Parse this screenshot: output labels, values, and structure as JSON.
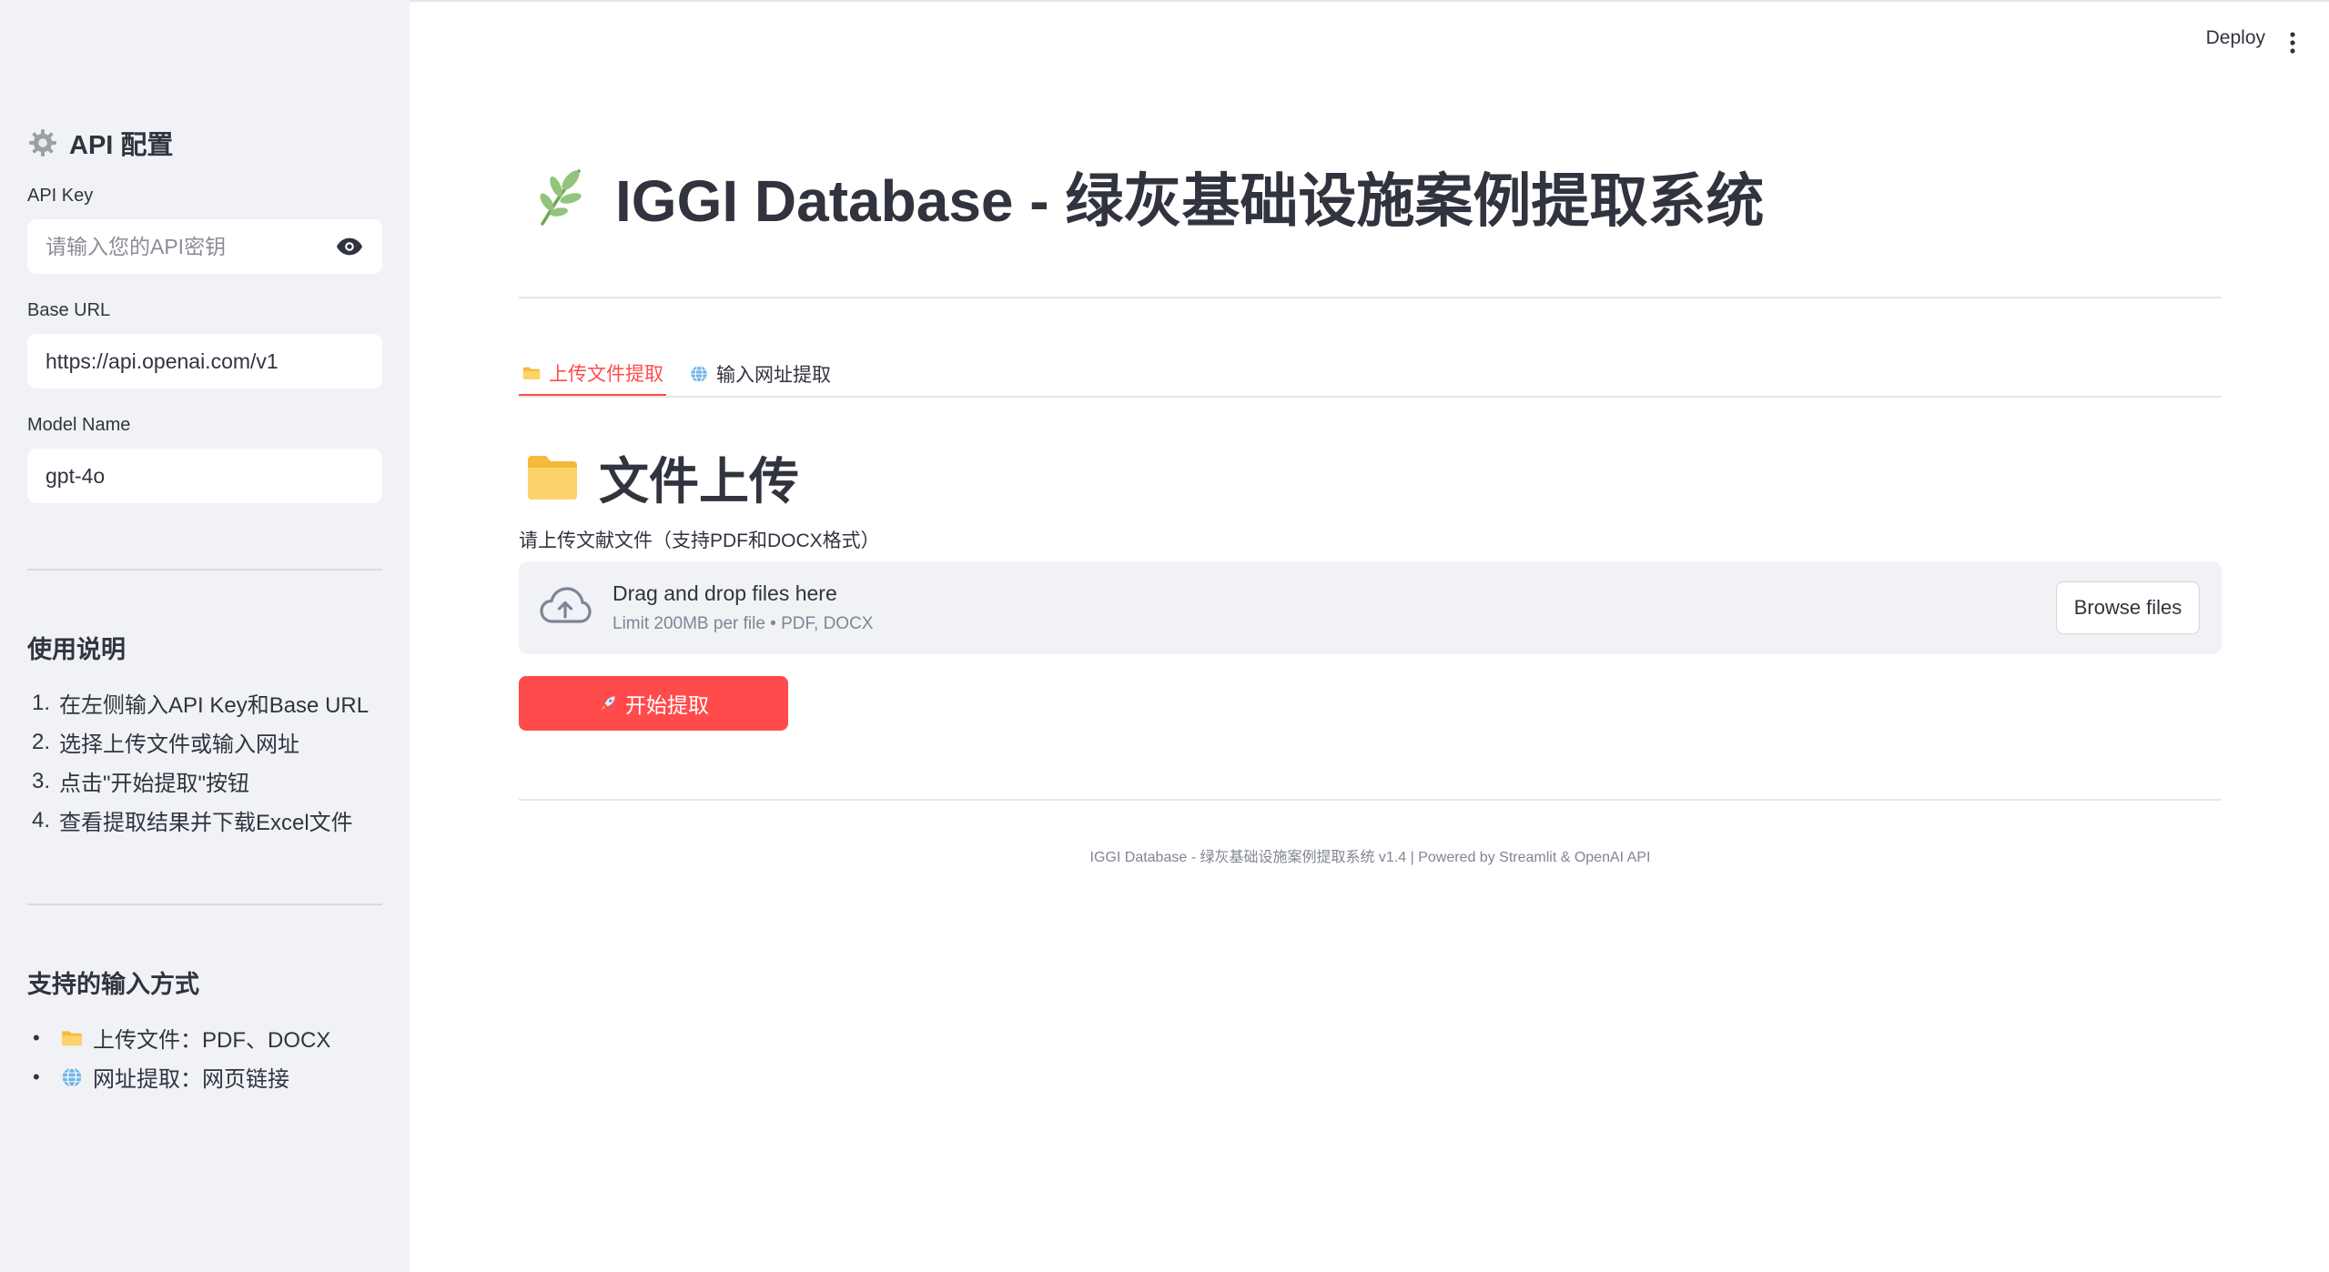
{
  "header": {
    "deploy_label": "Deploy"
  },
  "sidebar": {
    "heading": "API 配置",
    "api_key": {
      "label": "API Key",
      "placeholder": "请输入您的API密钥"
    },
    "base_url": {
      "label": "Base URL",
      "value": "https://api.openai.com/v1"
    },
    "model": {
      "label": "Model Name",
      "value": "gpt-4o"
    },
    "usage_title": "使用说明",
    "usage_steps": [
      {
        "num": "1.",
        "text": "在左侧输入API Key和Base URL"
      },
      {
        "num": "2.",
        "text": "选择上传文件或输入网址"
      },
      {
        "num": "3.",
        "text": "点击\"开始提取\"按钮"
      },
      {
        "num": "4.",
        "text": "查看提取结果并下载Excel文件"
      }
    ],
    "input_title": "支持的输入方式",
    "input_methods": [
      {
        "bullet": "•",
        "icon": "folder-icon",
        "text": "上传文件：PDF、DOCX"
      },
      {
        "bullet": "•",
        "icon": "globe-icon",
        "text": "网址提取：网页链接"
      }
    ]
  },
  "main": {
    "title": "IGGI Database - 绿灰基础设施案例提取系统",
    "title_icon": "sprout-icon",
    "tabs": [
      {
        "label": "上传文件提取",
        "icon": "folder-icon",
        "active": true
      },
      {
        "label": "输入网址提取",
        "icon": "globe-icon",
        "active": false
      }
    ],
    "section_title": "文件上传",
    "upload_label": "请上传文献文件（支持PDF和DOCX格式）",
    "dropzone": {
      "main_text": "Drag and drop files here",
      "sub_text": "Limit 200MB per file • PDF, DOCX",
      "browse_label": "Browse files"
    },
    "start_button": "开始提取",
    "footer": "IGGI Database - 绿灰基础设施案例提取系统 v1.4 | Powered by Streamlit & OpenAI API"
  },
  "colors": {
    "accent": "#ff4b4b",
    "sidebar_bg": "#f0f2f6",
    "text": "#31333f",
    "muted": "#808495"
  }
}
